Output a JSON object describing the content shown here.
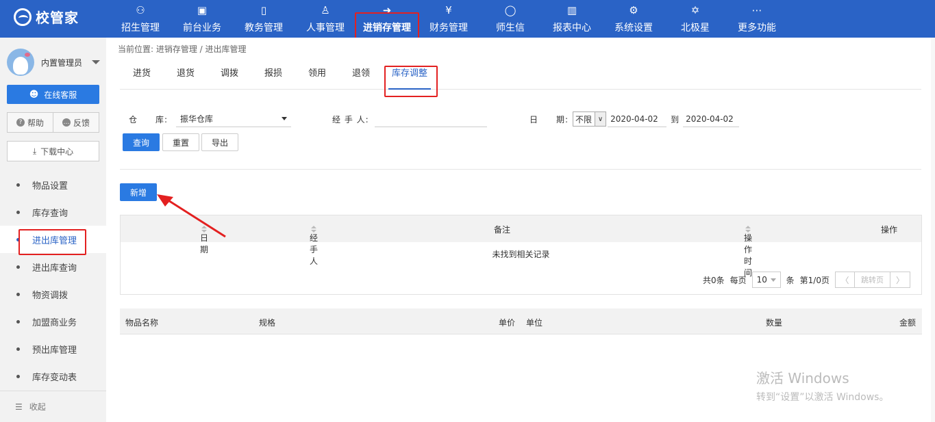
{
  "app": {
    "logo_text": "校管家"
  },
  "nav": [
    {
      "label": "招生管理",
      "icon": "user-plus-icon",
      "glyph": "⚇"
    },
    {
      "label": "前台业务",
      "icon": "monitor-icon",
      "glyph": "▣"
    },
    {
      "label": "教务管理",
      "icon": "book-icon",
      "glyph": "▯"
    },
    {
      "label": "人事管理",
      "icon": "person-icon",
      "glyph": "♙"
    },
    {
      "label": "进销存管理",
      "icon": "exit-box-icon",
      "glyph": "➜"
    },
    {
      "label": "财务管理",
      "icon": "yen-house-icon",
      "glyph": "¥"
    },
    {
      "label": "师生信",
      "icon": "chat-icon",
      "glyph": "◯"
    },
    {
      "label": "报表中心",
      "icon": "chart-icon",
      "glyph": "▥"
    },
    {
      "label": "系统设置",
      "icon": "gear-icon",
      "glyph": "⚙"
    },
    {
      "label": "北极星",
      "icon": "star-icon",
      "glyph": "✡"
    },
    {
      "label": "更多功能",
      "icon": "more-icon",
      "glyph": "⋯"
    }
  ],
  "sidebar": {
    "user_name": "内置管理员",
    "online_service": "在线客服",
    "help": "帮助",
    "feedback": "反馈",
    "download": "下载中心",
    "items": [
      {
        "label": "物品设置"
      },
      {
        "label": "库存查询"
      },
      {
        "label": "进出库管理"
      },
      {
        "label": "进出库查询"
      },
      {
        "label": "物资调拨"
      },
      {
        "label": "加盟商业务"
      },
      {
        "label": "预出库管理"
      },
      {
        "label": "库存变动表"
      }
    ],
    "collapse": "收起"
  },
  "breadcrumb": "当前位置: 进销存管理 / 进出库管理",
  "tabs": [
    "进货",
    "退货",
    "调拨",
    "报损",
    "领用",
    "退领",
    "库存调整"
  ],
  "form": {
    "warehouse_label": "仓　　库:",
    "warehouse_value": "振华仓库",
    "handler_label": "经 手 人:",
    "date_label": "日　　期:",
    "date_range": "不限",
    "date_from": "2020-04-02",
    "date_to_label": "到",
    "date_to": "2020-04-02",
    "query": "查询",
    "reset": "重置",
    "export": "导出"
  },
  "add_button": "新增",
  "table1": {
    "headers": [
      "日期",
      "经手人",
      "备注",
      "操作时间",
      "操作"
    ],
    "empty": "未找到相关记录",
    "pager": {
      "total": "共0条",
      "per_page_label": "每页",
      "per_page": "10",
      "unit": "条",
      "page": "第1/0页",
      "jump": "跳转页",
      "prev": "〈",
      "next": "〉"
    }
  },
  "table2": {
    "headers": [
      "物品名称",
      "规格",
      "单价",
      "单位",
      "数量",
      "金额"
    ]
  },
  "watermark": {
    "line1": "激活 Windows",
    "line2": "转到“设置”以激活 Windows。"
  }
}
